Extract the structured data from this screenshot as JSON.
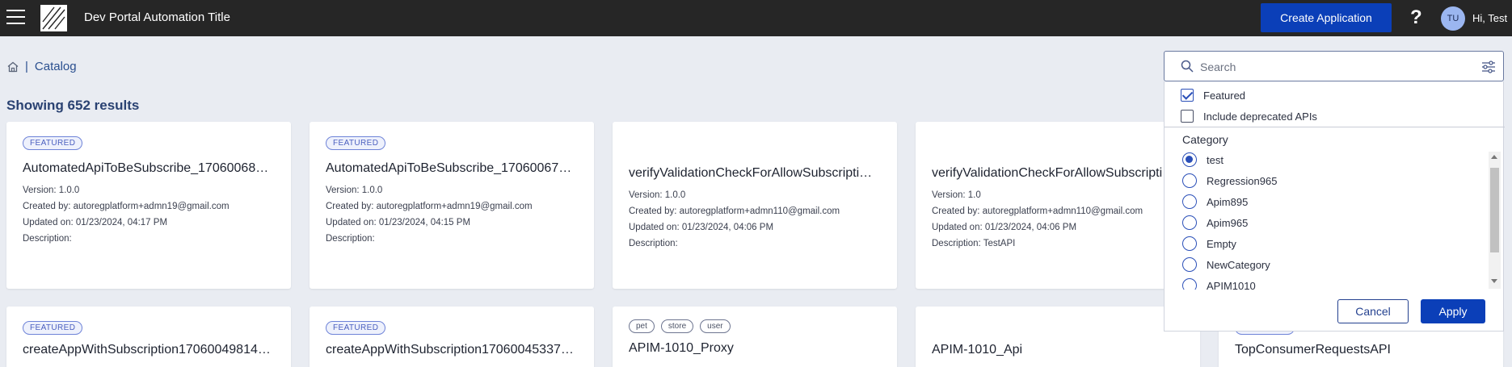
{
  "header": {
    "app_title": "Dev Portal Automation Title",
    "create_button": "Create Application",
    "help_label": "?",
    "avatar_initials": "TU",
    "greeting": "Hi, Test"
  },
  "breadcrumb": {
    "separator": "|",
    "current": "Catalog"
  },
  "results_text": "Showing 652 results",
  "cards_row1": [
    {
      "badge": "FEATURED",
      "title": "AutomatedApiToBeSubscribe_17060068…",
      "version": "Version: 1.0.0",
      "created_by": "Created by: autoregplatform+admn19@gmail.com",
      "updated_on": "Updated on: 01/23/2024, 04:17 PM",
      "description": "Description:"
    },
    {
      "badge": "FEATURED",
      "title": "AutomatedApiToBeSubscribe_17060067…",
      "version": "Version: 1.0.0",
      "created_by": "Created by: autoregplatform+admn19@gmail.com",
      "updated_on": "Updated on: 01/23/2024, 04:15 PM",
      "description": "Description:"
    },
    {
      "badge": "",
      "title": "verifyValidationCheckForAllowSubscripti…",
      "version": "Version: 1.0.0",
      "created_by": "Created by: autoregplatform+admn110@gmail.com",
      "updated_on": "Updated on: 01/23/2024, 04:06 PM",
      "description": "Description:"
    },
    {
      "badge": "",
      "title": "verifyValidationCheckForAllowSubscripti…",
      "version": "Version: 1.0",
      "created_by": "Created by: autoregplatform+admn110@gmail.com",
      "updated_on": "Updated on: 01/23/2024, 04:06 PM",
      "description": "Description: TestAPI"
    }
  ],
  "cards_row2": [
    {
      "badge": "FEATURED",
      "title": "createAppWithSubscription17060049814…"
    },
    {
      "badge": "FEATURED",
      "title": "createAppWithSubscription17060045337…"
    },
    {
      "tags": [
        "pet",
        "store",
        "user"
      ],
      "title": "APIM-1010_Proxy"
    },
    {
      "title": "APIM-1010_Api"
    },
    {
      "badge": "FEATURED",
      "title": "TopConsumerRequestsAPI"
    }
  ],
  "search": {
    "placeholder": "Search",
    "featured_label": "Featured",
    "featured_checked": true,
    "deprecated_label": "Include deprecated APIs",
    "deprecated_checked": false,
    "category_label": "Category",
    "categories": [
      "test",
      "Regression965",
      "Apim895",
      "Apim965",
      "Empty",
      "NewCategory",
      "APIM1010"
    ],
    "selected_category": "test",
    "cancel": "Cancel",
    "apply": "Apply"
  }
}
